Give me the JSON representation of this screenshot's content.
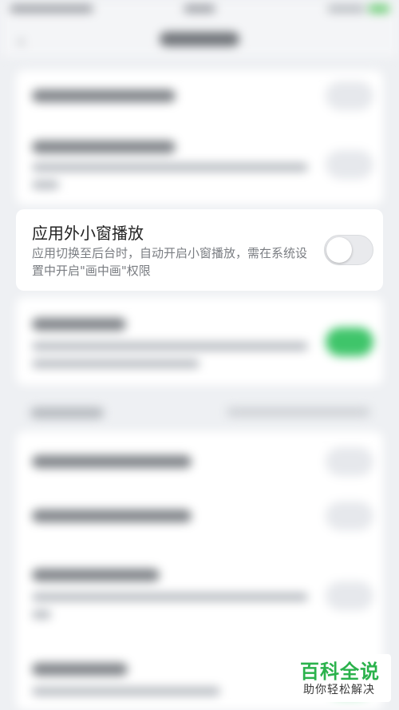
{
  "setting_row": {
    "title": "应用外小窗播放",
    "description": "应用切换至后台时，自动开启小窗播放，需在系统设置中开启\"画中画\"权限",
    "toggle_state": "off"
  },
  "watermark": {
    "brand": "百科全说",
    "tagline": "助你轻松解决"
  },
  "nav": {
    "back_icon": "chevron-left-icon"
  },
  "colors": {
    "toggle_on": "#3fc56a",
    "brand_green": "#2bb24c"
  }
}
